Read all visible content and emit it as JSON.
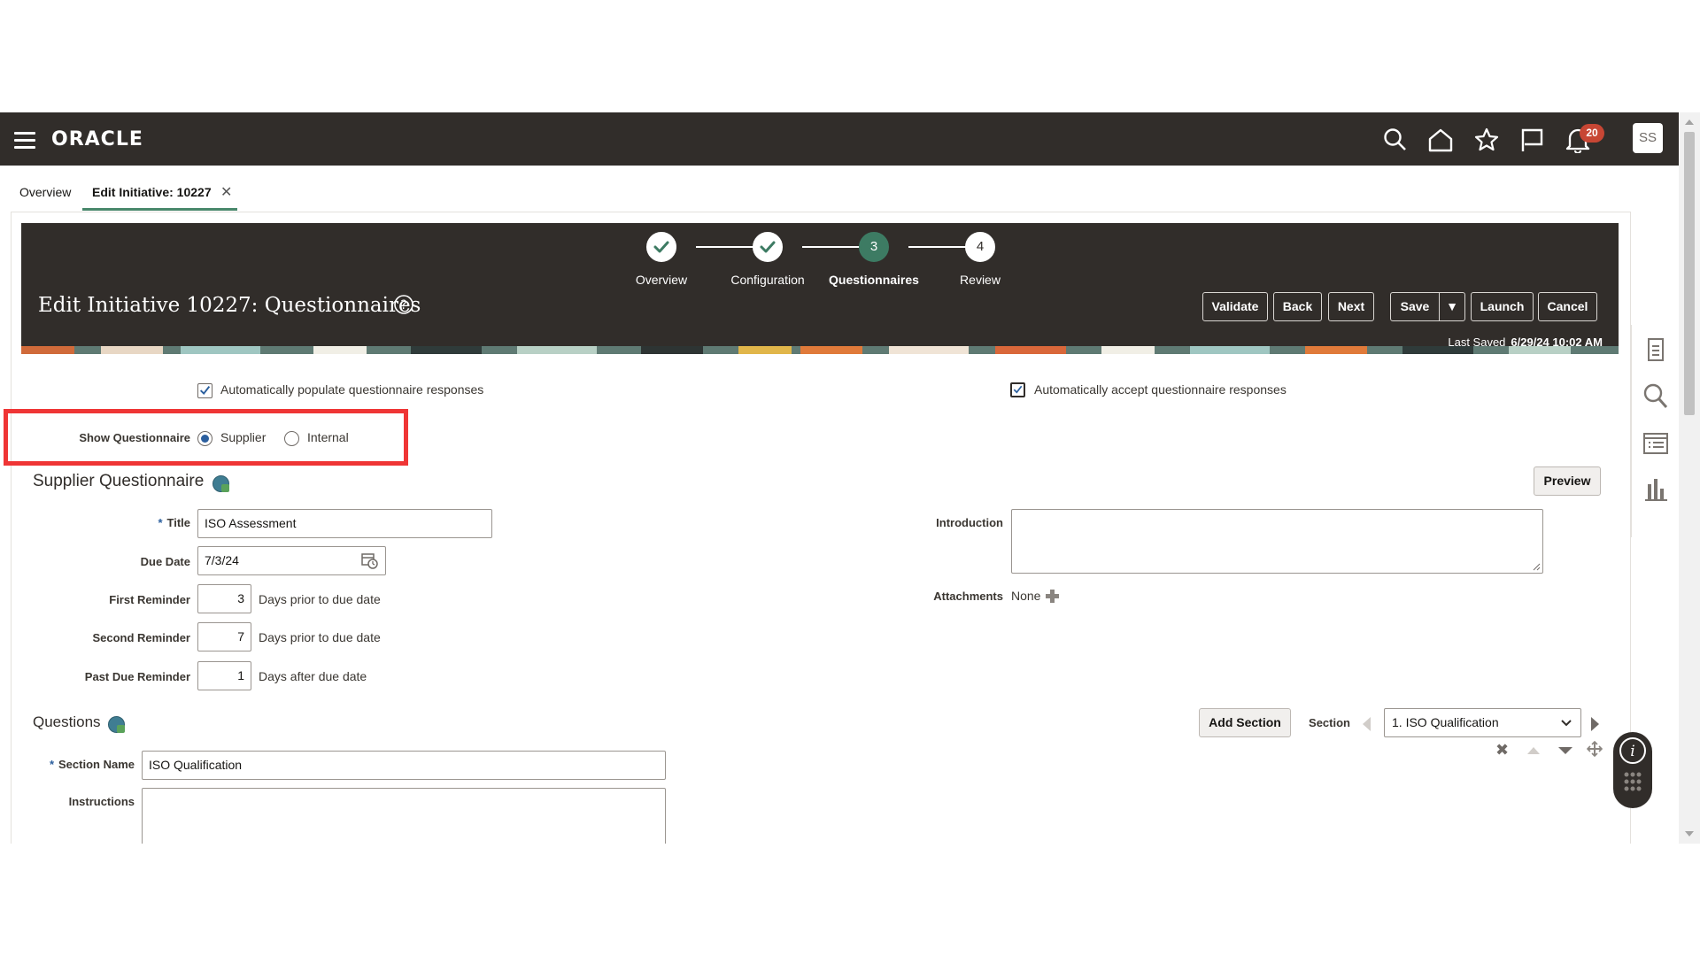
{
  "topbar": {
    "logo": "ORACLE",
    "notification_count": "20",
    "avatar_initials": "SS",
    "icons": [
      "menu-icon",
      "search-icon",
      "home-icon",
      "star-icon",
      "flag-icon",
      "bell-icon"
    ]
  },
  "tabs": [
    {
      "label": "Overview",
      "active": false
    },
    {
      "label": "Edit Initiative: 10227",
      "active": true,
      "closable": true
    }
  ],
  "header": {
    "title": "Edit Initiative 10227: Questionnaires",
    "train": [
      {
        "number": "1",
        "label": "Overview",
        "state": "complete"
      },
      {
        "number": "2",
        "label": "Configuration",
        "state": "complete"
      },
      {
        "number": "3",
        "label": "Questionnaires",
        "state": "current"
      },
      {
        "number": "4",
        "label": "Review",
        "state": "pending"
      }
    ],
    "buttons": {
      "validate": "Validate",
      "back": "Back",
      "next": "Next",
      "save": "Save",
      "launch": "Launch",
      "cancel": "Cancel"
    },
    "last_saved_label": "Last Saved",
    "last_saved_value": "6/29/24 10:02 AM"
  },
  "options": {
    "auto_populate_label": "Automatically populate questionnaire responses",
    "auto_populate_checked": true,
    "auto_accept_label": "Automatically accept questionnaire responses",
    "auto_accept_checked": true,
    "show_questionnaire_label": "Show Questionnaire",
    "show_questionnaire_options": [
      "Supplier",
      "Internal"
    ],
    "show_questionnaire_selected": "Supplier"
  },
  "supplier_questionnaire": {
    "heading": "Supplier Questionnaire",
    "preview_button": "Preview",
    "title_label": "Title",
    "title_value": "ISO Assessment",
    "due_date_label": "Due Date",
    "due_date_value": "7/3/24",
    "first_reminder_label": "First Reminder",
    "first_reminder_value": "3",
    "first_reminder_suffix": "Days prior to due date",
    "second_reminder_label": "Second Reminder",
    "second_reminder_value": "7",
    "second_reminder_suffix": "Days prior to due date",
    "past_due_label": "Past Due Reminder",
    "past_due_value": "1",
    "past_due_suffix": "Days after due date",
    "introduction_label": "Introduction",
    "attachments_label": "Attachments",
    "attachments_value": "None"
  },
  "questions": {
    "heading": "Questions",
    "add_section_button": "Add Section",
    "section_label": "Section",
    "section_selected": "1. ISO Qualification",
    "section_name_label": "Section Name",
    "section_name_value": "ISO Qualification",
    "instructions_label": "Instructions"
  },
  "colors": {
    "header_bg": "#312d2a",
    "train_current": "#3d7b63",
    "highlight": "#ef3535",
    "badge": "#c74634"
  }
}
